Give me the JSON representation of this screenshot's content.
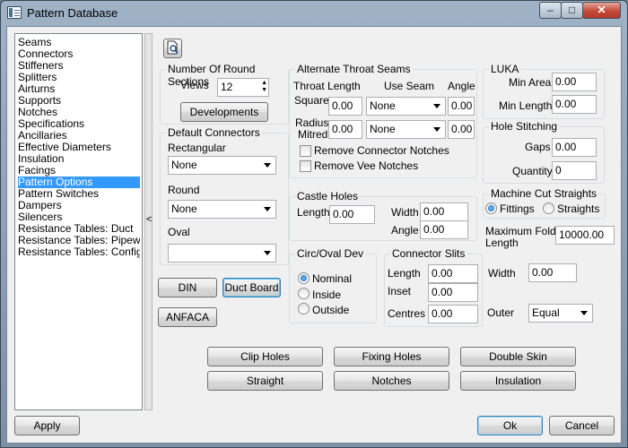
{
  "window": {
    "title": "Pattern Database",
    "min": "–",
    "max": "□",
    "close": "✕"
  },
  "sidebar": {
    "items": [
      "Seams",
      "Connectors",
      "Stiffeners",
      "Splitters",
      "Airturns",
      "Supports",
      "Notches",
      "Specifications",
      "Ancillaries",
      "Effective Diameters",
      "Insulation",
      "Facings",
      "Pattern Options",
      "Pattern Switches",
      "Dampers",
      "Silencers",
      "Resistance Tables: Duct",
      "Resistance Tables: Pipework",
      "Resistance Tables: Configura"
    ],
    "selected_index": 12,
    "splitter_glyph": "<"
  },
  "round_sections": {
    "title": "Number Of Round Sections",
    "views_label": "Views",
    "views_value": "12",
    "developments": "Developments"
  },
  "default_connectors": {
    "title": "Default Connectors",
    "rect_label": "Rectangular",
    "rect_value": "None",
    "round_label": "Round",
    "round_value": "None",
    "oval_label": "Oval",
    "oval_value": ""
  },
  "alt_throat": {
    "title": "Alternate Throat Seams",
    "col_length": "Throat Length",
    "col_seam": "Use Seam",
    "col_angle": "Angle",
    "square_label": "Square",
    "square_length": "0.00",
    "square_seam": "None",
    "square_angle": "0.00",
    "radius_label": "Radius",
    "mitred_label": "Mitred",
    "radius_length": "0.00",
    "radius_seam": "None",
    "radius_angle": "0.00",
    "remove_connector": "Remove Connector Notches",
    "remove_vee": "Remove Vee Notches"
  },
  "castle": {
    "title": "Castle Holes",
    "length_label": "Length",
    "length": "0.00",
    "width_label": "Width",
    "width": "0.00",
    "angle_label": "Angle",
    "angle": "0.00"
  },
  "circ_oval": {
    "title": "Circ/Oval Dev",
    "nominal": "Nominal",
    "inside": "Inside",
    "outside": "Outside"
  },
  "slits": {
    "title": "Connector Slits",
    "length_label": "Length",
    "length": "0.00",
    "inset_label": "Inset",
    "inset": "0.00",
    "centres_label": "Centres",
    "centres": "0.00"
  },
  "luka": {
    "title": "LUKA",
    "min_area_label": "Min Area",
    "min_area": "0.00",
    "min_length_label": "Min Length",
    "min_length": "0.00"
  },
  "hole_stitching": {
    "title": "Hole Stitching",
    "gaps_label": "Gaps",
    "gaps": "0.00",
    "quantity_label": "Quantity",
    "quantity": "0"
  },
  "machine_cut": {
    "title": "Machine Cut Straights",
    "fittings": "Fittings",
    "straights": "Straights"
  },
  "fold": {
    "label_line1": "Maximum Fold",
    "label_line2": "Length",
    "value": "10000.00"
  },
  "misc": {
    "width_label": "Width",
    "width": "0.00",
    "outer_label": "Outer",
    "outer_value": "Equal"
  },
  "buttons": {
    "din": "DIN",
    "duct_board": "Duct Board",
    "anfaca": "ANFACA",
    "clip_holes": "Clip Holes",
    "fixing_holes": "Fixing Holes",
    "double_skin": "Double Skin",
    "straight": "Straight",
    "notches": "Notches",
    "insulation": "Insulation",
    "apply": "Apply",
    "ok": "Ok",
    "cancel": "Cancel"
  }
}
